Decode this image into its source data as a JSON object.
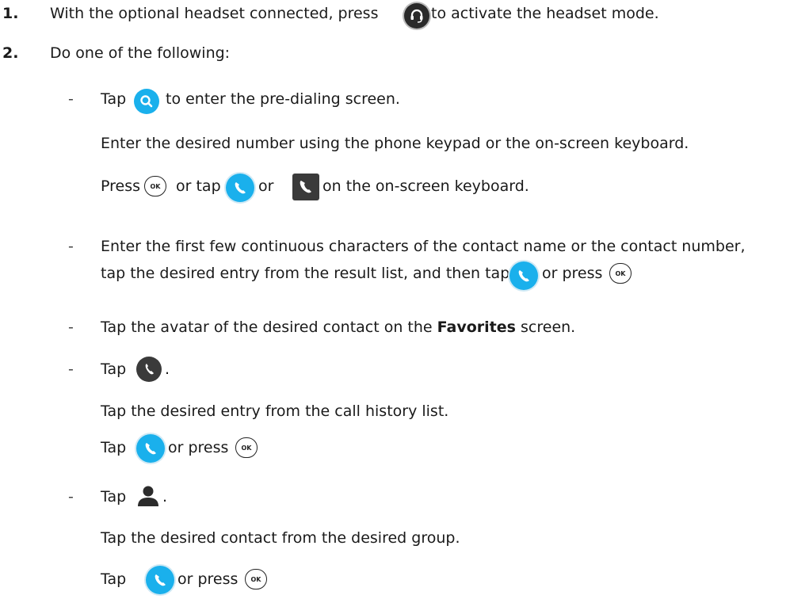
{
  "steps": [
    {
      "number": "1.",
      "text_before": "With the optional headset connected, press",
      "text_after": "to activate the headset mode."
    },
    {
      "number": "2.",
      "text": "Do one of the following:"
    }
  ],
  "options": {
    "dash": "-",
    "a": {
      "tap": "Tap",
      "line1_after": "to enter the pre-dialing screen.",
      "line2": "Enter the desired number using the phone keypad or the on-screen keyboard.",
      "line3_press": "Press",
      "line3_or_tap": "or tap",
      "line3_or": "or",
      "line3_after": "on the on-screen keyboard."
    },
    "b": {
      "line1": "Enter the first few continuous characters of the contact name or the contact number,",
      "line2_before": "tap the desired entry from the result list, and then tap",
      "line2_or_press": "or press"
    },
    "c": {
      "before": "Tap the avatar of the desired contact on the",
      "bold": "Favorites",
      "after": "screen."
    },
    "d": {
      "tap": "Tap",
      "period": ".",
      "line2": "Tap the desired entry from the call history list.",
      "line3_tap": "Tap",
      "line3_or_press": "or press"
    },
    "e": {
      "tap": "Tap",
      "period": ".",
      "line2": "Tap the desired contact from the desired group.",
      "line3_tap": "Tap",
      "line3_or_press": "or press"
    }
  },
  "ok_label": "OK",
  "icons": {
    "headset": "headset-icon",
    "search": "search-icon",
    "call": "call-icon",
    "keyboard_call": "keyboard-call-icon",
    "history": "history-icon",
    "contacts": "contacts-icon"
  },
  "colors": {
    "blue": "#1ab0ec",
    "dark": "#2b2b2b"
  }
}
